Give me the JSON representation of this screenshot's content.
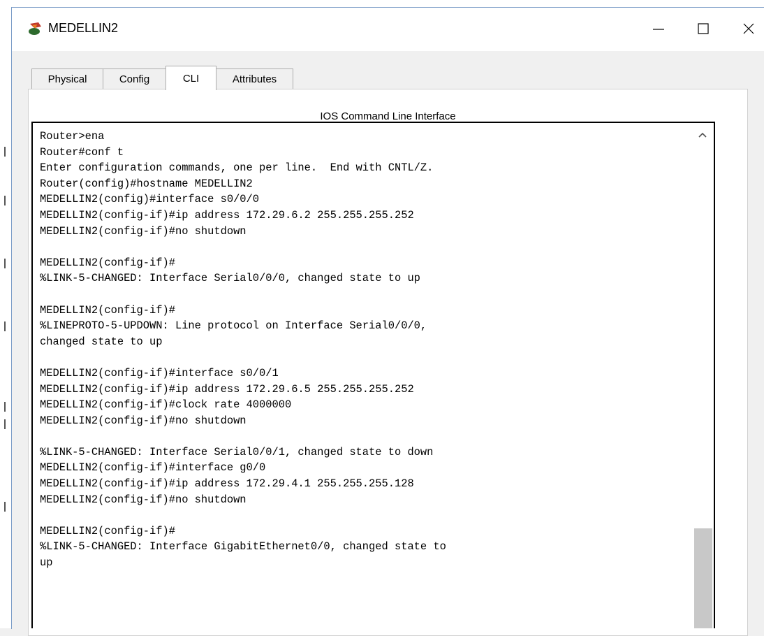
{
  "window": {
    "title": "MEDELLIN2",
    "icon": "packet-tracer-router-icon",
    "controls": {
      "minimize": "minimize-icon",
      "maximize": "maximize-icon",
      "close": "close-icon"
    }
  },
  "tabs": [
    {
      "label": "Physical",
      "active": false
    },
    {
      "label": "Config",
      "active": false
    },
    {
      "label": "CLI",
      "active": true
    },
    {
      "label": "Attributes",
      "active": false
    }
  ],
  "panel": {
    "title": "IOS Command Line Interface"
  },
  "cli": {
    "lines": [
      "Router>ena",
      "Router#conf t",
      "Enter configuration commands, one per line.  End with CNTL/Z.",
      "Router(config)#hostname MEDELLIN2",
      "MEDELLIN2(config)#interface s0/0/0",
      "MEDELLIN2(config-if)#ip address 172.29.6.2 255.255.255.252",
      "MEDELLIN2(config-if)#no shutdown",
      "",
      "MEDELLIN2(config-if)#",
      "%LINK-5-CHANGED: Interface Serial0/0/0, changed state to up",
      "",
      "MEDELLIN2(config-if)#",
      "%LINEPROTO-5-UPDOWN: Line protocol on Interface Serial0/0/0,",
      "changed state to up",
      "",
      "MEDELLIN2(config-if)#interface s0/0/1",
      "MEDELLIN2(config-if)#ip address 172.29.6.5 255.255.255.252",
      "MEDELLIN2(config-if)#clock rate 4000000",
      "MEDELLIN2(config-if)#no shutdown",
      "",
      "%LINK-5-CHANGED: Interface Serial0/0/1, changed state to down",
      "MEDELLIN2(config-if)#interface g0/0",
      "MEDELLIN2(config-if)#ip address 172.29.4.1 255.255.255.128",
      "MEDELLIN2(config-if)#no shutdown",
      "",
      "MEDELLIN2(config-if)#",
      "%LINK-5-CHANGED: Interface GigabitEthernet0/0, changed state to",
      "up"
    ]
  },
  "scrollbar": {
    "up_icon": "scroll-up-arrow-icon"
  }
}
